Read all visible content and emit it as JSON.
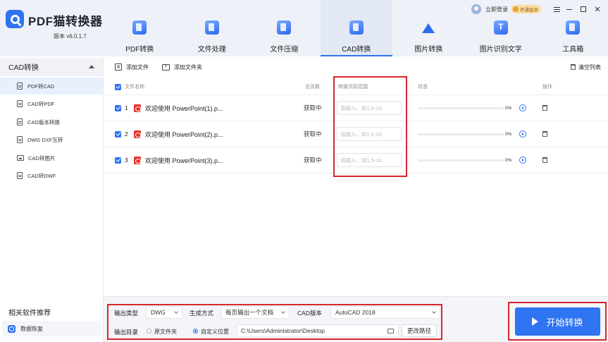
{
  "app": {
    "name": "PDF猫转换器",
    "version": "版本 v6.0.1.7"
  },
  "top_right": {
    "login": "立即登录",
    "vip": "开通会员"
  },
  "tabs": [
    {
      "label": "PDF转换",
      "icon": "pdf-convert-icon"
    },
    {
      "label": "文件处理",
      "icon": "file-process-icon"
    },
    {
      "label": "文件压缩",
      "icon": "file-compress-icon"
    },
    {
      "label": "CAD转换",
      "icon": "cad-convert-icon",
      "active": true
    },
    {
      "label": "图片转换",
      "icon": "image-convert-icon"
    },
    {
      "label": "图片识别文字",
      "icon": "ocr-icon",
      "glyph": "T"
    },
    {
      "label": "工具箱",
      "icon": "toolbox-icon"
    }
  ],
  "sidebar": {
    "group": "CAD转换",
    "items": [
      {
        "label": "PDF转CAD",
        "active": true
      },
      {
        "label": "CAD转PDF"
      },
      {
        "label": "CAD版本转换"
      },
      {
        "label": "DWG DXF互转"
      },
      {
        "label": "CAD转图片"
      },
      {
        "label": "CAD转DWF"
      }
    ],
    "related_title": "相关软件推荐",
    "related_item": "数据恢复"
  },
  "toolbar": {
    "add_file": "添加文件",
    "add_folder": "添加文件夹",
    "clear_list": "清空列表"
  },
  "table": {
    "headers": {
      "name": "文件名称",
      "pages": "总页数",
      "range": "转换页码范围",
      "status": "状态",
      "action": "操作"
    },
    "range_placeholder": "请输入，如1,5-10",
    "rows": [
      {
        "num": "1",
        "name": "欢迎使用 PowerPoint(1).p...",
        "pages": "获取中",
        "range": "",
        "progress": 0,
        "percent": "0%"
      },
      {
        "num": "2",
        "name": "欢迎使用 PowerPoint(2).p...",
        "pages": "获取中",
        "range": "",
        "progress": 0,
        "percent": "0%"
      },
      {
        "num": "3",
        "name": "欢迎使用 PowerPoint(3).p...",
        "pages": "获取中",
        "range": "",
        "progress": 0,
        "percent": "0%"
      }
    ]
  },
  "bottom": {
    "output_type_label": "输出类型",
    "output_type": "DWG",
    "gen_mode_label": "生成方式",
    "gen_mode": "每页输出一个文档",
    "cad_version_label": "CAD版本",
    "cad_version": "AutoCAD 2018",
    "output_dir_label": "输出目录",
    "opt_source": "原文件夹",
    "opt_custom": "自定义位置",
    "path": "C:\\Users\\Administrator\\Desktop",
    "change_path": "更改路径",
    "start": "开始转换"
  },
  "colors": {
    "accent": "#2f74f0",
    "highlight_box": "#d9262c",
    "ppt": "#e5352b"
  }
}
